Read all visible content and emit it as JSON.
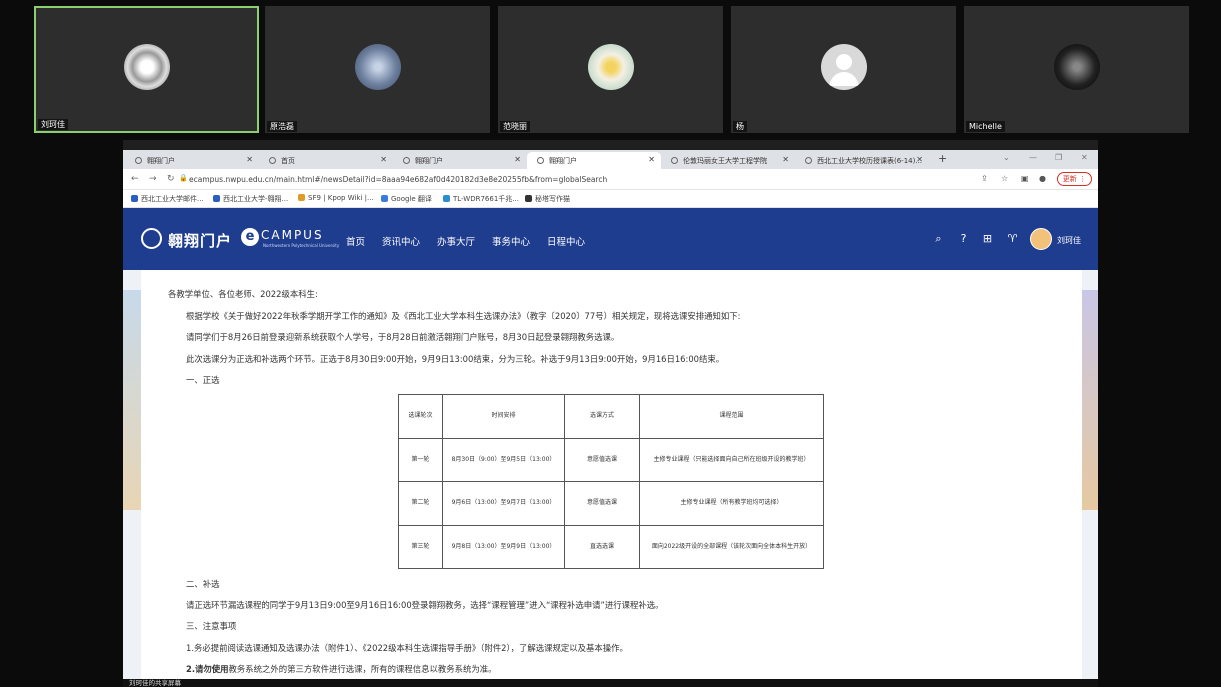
{
  "participants": [
    {
      "name": "刘珂佳",
      "active": true
    },
    {
      "name": "原浩磊",
      "active": false
    },
    {
      "name": "范晓丽",
      "active": false
    },
    {
      "name": "杨",
      "active": false
    },
    {
      "name": "Michelle",
      "active": false
    }
  ],
  "browser": {
    "tabs": [
      {
        "label": "翱翔门户"
      },
      {
        "label": "首页"
      },
      {
        "label": "翱翔门户"
      },
      {
        "label": "翱翔门户"
      },
      {
        "label": "伦敦玛丽女王大学工程学院"
      },
      {
        "label": "西北工业大学校历授课表(6-14)..."
      }
    ],
    "url": "ecampus.nwpu.edu.cn/main.html#/newsDetail?id=8aaa94e682af0d420182d3e8e20255fb&from=globalSearch",
    "update_label": "更新",
    "bookmarks": [
      {
        "label": "西北工业大学邮件...",
        "color": "#2b5fbf"
      },
      {
        "label": "西北工业大学-翱翔...",
        "color": "#2b5fbf"
      },
      {
        "label": "SF9 | Kpop Wiki |...",
        "color": "#e09a2a"
      },
      {
        "label": "Google 翻译",
        "color": "#3a7be0"
      },
      {
        "label": "TL-WDR7661千兆...",
        "color": "#2a8fd0"
      },
      {
        "label": "秘塔写作猫",
        "color": "#333333"
      }
    ]
  },
  "portal": {
    "logo_cn": "翱翔门户",
    "logo_en": "CAMPUS",
    "logo_e": "e",
    "logo_sub": "Northwestern Polytechnical University",
    "menu": [
      "首页",
      "资讯中心",
      "办事大厅",
      "事务中心",
      "日程中心"
    ],
    "user": "刘珂佳"
  },
  "article": {
    "greeting": "各教学单位、各位老师、2022级本科生:",
    "para1": "根据学校《关于做好2022年秋季学期开学工作的通知》及《西北工业大学本科生选课办法》（教字〔2020〕77号）相关规定，现将选课安排通知如下:",
    "para2": "请同学们于8月26日前登录迎新系统获取个人学号，于8月28日前激活翱翔门户账号，8月30日起登录翱翔教务选课。",
    "para3": "此次选课分为正选和补选两个环节。正选于8月30日9:00开始，9月9日13:00结束，分为三轮。补选于9月13日9:00开始，9月16日16:00结束。",
    "section1": "一、正选",
    "section2": "二、补选",
    "para4": "请正选环节漏选课程的同学于9月13日9:00至9月16日16:00登录翱翔教务，选择“课程管理”进入“课程补选申请”进行课程补选。",
    "section3": "三、注意事项",
    "note1": "1.务必提前阅读选课通知及选课办法（附件1）、《2022级本科生选课指导手册》（附件2），了解选课规定以及基本操作。",
    "note2_bold": "2.请勿使用",
    "note2_rest": "教务系统之外的第三方软件进行选课，所有的课程信息以教务系统为准。"
  },
  "table": {
    "headers": [
      "选课轮次",
      "时间安排",
      "选课方式",
      "课程范围"
    ],
    "rows": [
      [
        "第一轮",
        "8月30日（9:00）至9月5日（13:00）",
        "意愿值选课",
        "主修专业课程（只能选择面向自己所在班级开设的教学班）"
      ],
      [
        "第二轮",
        "9月6日（13:00）至9月7日（13:00）",
        "意愿值选课",
        "主修专业课程（所有教学班均可选择）"
      ],
      [
        "第三轮",
        "9月8日（13:00）至9月9日（13:00）",
        "直选选课",
        "面向2022级开设的全部课程（该轮次面向全体本科生开放）"
      ]
    ]
  },
  "share_label": "刘珂佳的共享屏幕"
}
